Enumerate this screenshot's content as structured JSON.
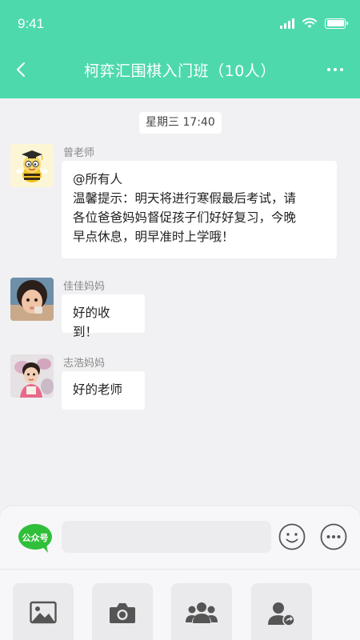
{
  "status_bar": {
    "time": "9:41"
  },
  "nav": {
    "title": "柯弈汇围棋入门班（10人）"
  },
  "chat": {
    "time_label": "星期三 17:40",
    "messages": [
      {
        "sender": "曾老师",
        "avatar": "cartoon-teacher-avatar",
        "lines": [
          "@所有人",
          "温馨提示：明天将进行寒假最后考试，请",
          "各位爸爸妈妈督促孩子们好好复习，今晚",
          "早点休息，明早准时上学哦！"
        ]
      },
      {
        "sender": "佳佳妈妈",
        "avatar": "child-photo-avatar",
        "lines": [
          "好的收到！"
        ]
      },
      {
        "sender": "志浩妈妈",
        "avatar": "child-photo-avatar-2",
        "lines": [
          "好的老师"
        ]
      }
    ]
  },
  "input_bar": {
    "official_account_badge": "公众号",
    "text_value": "",
    "buttons": [
      "emoji-icon",
      "more-options-icon"
    ]
  },
  "toolbar": {
    "tools": [
      "image-icon",
      "camera-icon",
      "group-icon",
      "contact-card-icon"
    ]
  },
  "colors": {
    "accent": "#4ed9ad",
    "badge_green": "#2fbf3a",
    "background": "#f1f1f3"
  }
}
